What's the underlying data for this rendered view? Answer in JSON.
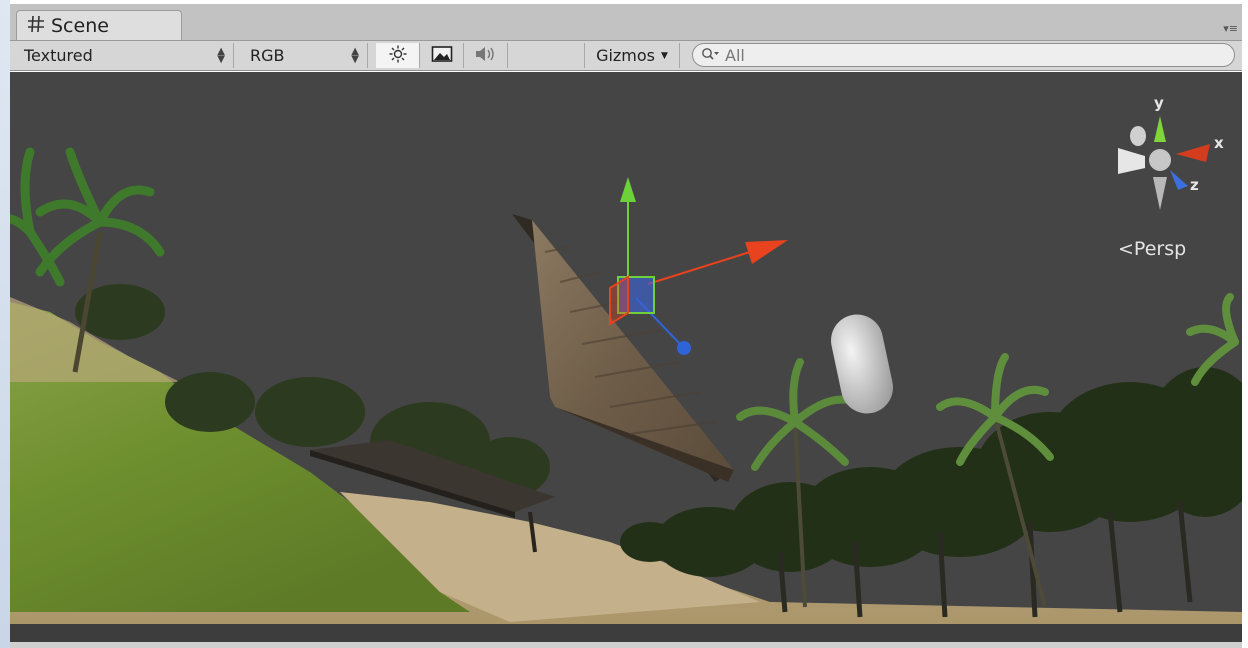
{
  "window": {
    "tab_title": "Scene",
    "menu_icon": "panel-menu-icon"
  },
  "toolbar": {
    "render_mode": "Textured",
    "color_mode": "RGB",
    "lighting_icon": "sun-icon",
    "effects_icon": "image-icon",
    "audio_icon": "speaker-icon",
    "gizmos_label": "Gizmos",
    "search_placeholder": "All",
    "search_icon": "search-icon"
  },
  "viewport": {
    "background_color": "#454545",
    "orientation_gizmo": {
      "axis_labels": {
        "x": "x",
        "y": "y",
        "z": "z"
      },
      "projection": "Persp",
      "colors": {
        "x": "#d43c1e",
        "y": "#7fd53a",
        "z": "#3b6fe0"
      }
    },
    "move_gizmo_colors": {
      "x": "#e8421e",
      "y": "#6dd23a",
      "z": "#2f63d8"
    }
  }
}
